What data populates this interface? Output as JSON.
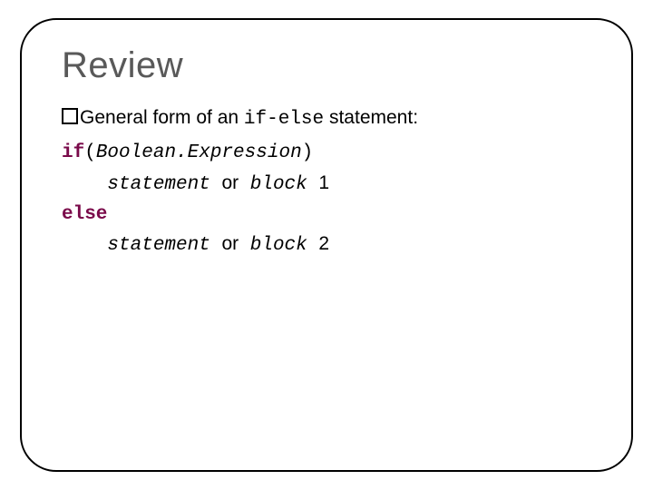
{
  "title": "Review",
  "bullet": {
    "pre": "General form of an ",
    "code": "if-else",
    "post": " statement:"
  },
  "code": {
    "kw_if": "if",
    "paren_open": "(",
    "bool_expr": "Boolean.Expression",
    "paren_close": ")",
    "indent": "    ",
    "stmt_a": "statement ",
    "or_txt": "or",
    "block_a": " block ",
    "one": "1",
    "kw_else": "else",
    "stmt_b": "statement ",
    "block_b": " block ",
    "two": "2"
  }
}
